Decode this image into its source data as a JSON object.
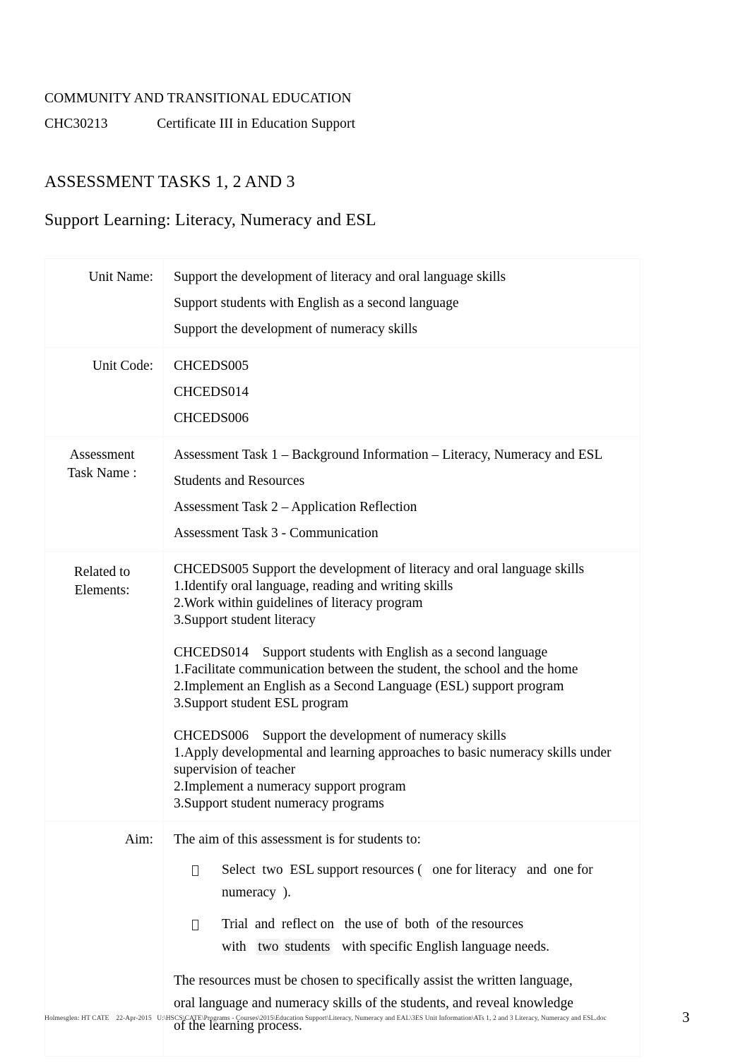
{
  "header": {
    "org_line": "COMMUNITY AND TRANSITIONAL EDUCATION",
    "course_line": "CHC30213              Certificate III in Education Support"
  },
  "titles": {
    "main": "ASSESSMENT TASKS 1, 2 AND 3",
    "sub": "Support Learning: Literacy, Numeracy and ESL"
  },
  "table": {
    "unit_name": {
      "label": "Unit Name:",
      "lines": [
        "Support the development of literacy and oral language skills",
        "Support students with English as a second language",
        "Support the development of numeracy skills"
      ]
    },
    "unit_code": {
      "label": "Unit Code:",
      "lines": [
        "CHCEDS005",
        "CHCEDS014",
        "CHCEDS006"
      ]
    },
    "task_name": {
      "label_line_1": "Assessment",
      "label_line_2": "Task Name :",
      "lines": [
        "Assessment Task 1 – Background Information – Literacy, Numeracy and ESL",
        "Students and Resources",
        "Assessment Task 2 – Application Reflection",
        "Assessment Task 3 - Communication"
      ]
    },
    "elements": {
      "label_line_1": "Related to",
      "label_line_2": "Elements:",
      "groups": [
        {
          "heading": "CHCEDS005 Support the development of literacy and oral language skills",
          "items": [
            "1.Identify oral language, reading and writing skills",
            "2.Work within guidelines of literacy program",
            "3.Support student literacy"
          ]
        },
        {
          "heading": "CHCEDS014    Support students with English as a second language",
          "items": [
            "1.Facilitate communication between the student, the school and the home",
            "2.Implement an English as a Second Language (ESL) support program",
            "3.Support student ESL program"
          ]
        },
        {
          "heading": "CHCEDS006    Support the development of numeracy skills",
          "items": [
            "1.Apply developmental and learning approaches to basic numeracy skills under supervision of teacher",
            "2.Implement a numeracy support program",
            "3.Support student numeracy programs"
          ]
        }
      ]
    },
    "aim": {
      "label": "Aim:",
      "intro": "The aim of this assessment is for students to:",
      "bullets": [
        {
          "prefix": "Select  two  ESL support resources (   one for literacy   and  one for numeracy  ).",
          "segments": [
            {
              "text": "Select  two  ESL support resources (   one for literacy   and  one for numeracy  ).",
              "shaded": false
            }
          ]
        },
        {
          "prefix": "Trial  and  reflect on   the use of  both  of the resources with   ",
          "shaded_1": "two",
          "middle": " ",
          "shaded_2": "students",
          "suffix": "   with specific English language needs.",
          "segments": [
            {
              "text": "Trial  and  reflect on   the use of  both  of the resources with   ",
              "shaded": false
            },
            {
              "text": "two",
              "shaded": true
            },
            {
              "text": " ",
              "shaded": false
            },
            {
              "text": "students",
              "shaded": true
            },
            {
              "text": "   with specific English language needs.",
              "shaded": false
            }
          ]
        }
      ],
      "closing": "The resources must be chosen to specifically assist the written language,\noral language and numeracy skills of the students, and reveal knowledge\nof the learning process."
    }
  },
  "footer": {
    "text": "Holmesglen: HT CATE    22-Apr-2015   U:\\HSCS\\CATE\\Programs - Courses\\2015\\Education Support\\Literacy, Numeracy and EAL\\3ES Unit Information\\ATs 1, 2 and 3 Literacy, Numeracy and ESL.doc",
    "page_number": "3"
  }
}
